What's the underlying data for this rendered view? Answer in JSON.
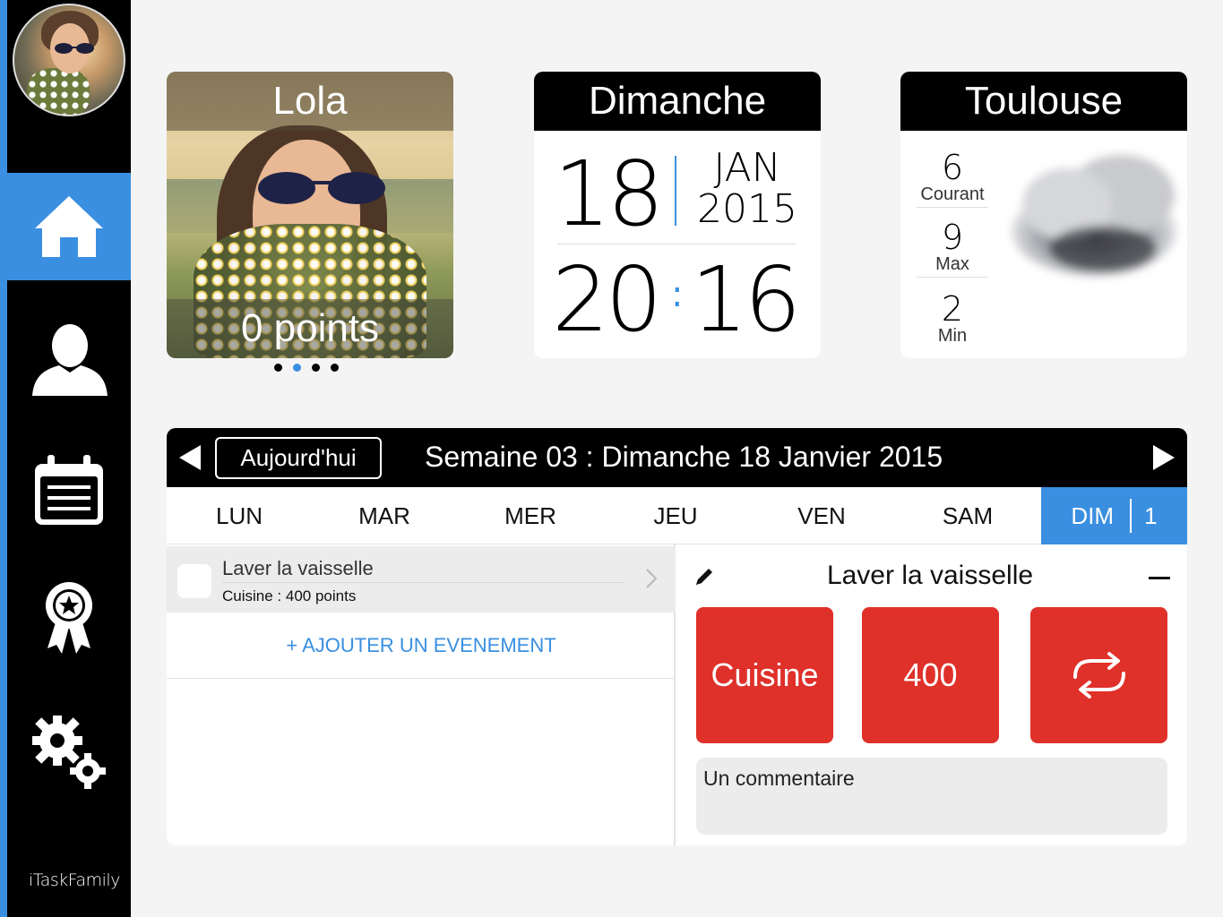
{
  "sidebar": {
    "brand": "iTaskFamily",
    "nav": [
      {
        "id": "home",
        "icon": "home-icon",
        "active": true
      },
      {
        "id": "profile",
        "icon": "user-icon",
        "active": false
      },
      {
        "id": "calendar",
        "icon": "calendar-icon",
        "active": false
      },
      {
        "id": "awards",
        "icon": "award-icon",
        "active": false
      },
      {
        "id": "settings",
        "icon": "gears-icon",
        "active": false
      }
    ]
  },
  "profile": {
    "name": "Lola",
    "points": "0 points",
    "page_dots": 4,
    "active_dot": 2
  },
  "date": {
    "weekday": "Dimanche",
    "day": "18",
    "month": "JAN",
    "year": "2015",
    "hours": "20",
    "minutes": "16",
    "colon": ":"
  },
  "weather": {
    "city": "Toulouse",
    "current": {
      "value": "6",
      "label": "Courant"
    },
    "max": {
      "value": "9",
      "label": "Max"
    },
    "min": {
      "value": "2",
      "label": "Min"
    },
    "condition_icon": "cloud-icon"
  },
  "calendar": {
    "today_label": "Aujourd'hui",
    "week_title": "Semaine 03 : Dimanche 18 Janvier 2015",
    "days": [
      "LUN",
      "MAR",
      "MER",
      "JEU",
      "VEN",
      "SAM",
      "DIM"
    ],
    "active_day": "DIM",
    "active_day_count": "1",
    "events": [
      {
        "title": "Laver la vaisselle",
        "subtitle": "Cuisine : 400 points"
      }
    ],
    "add_event_label": "+ AJOUTER UN EVENEMENT"
  },
  "detail": {
    "title": "Laver la vaisselle",
    "category": "Cuisine",
    "points": "400",
    "repeat_icon": "repeat-icon",
    "comment_placeholder": "Un commentaire"
  },
  "colors": {
    "accent": "#3a8fe0",
    "tile_red": "#e0302a",
    "bar": "#000000"
  }
}
